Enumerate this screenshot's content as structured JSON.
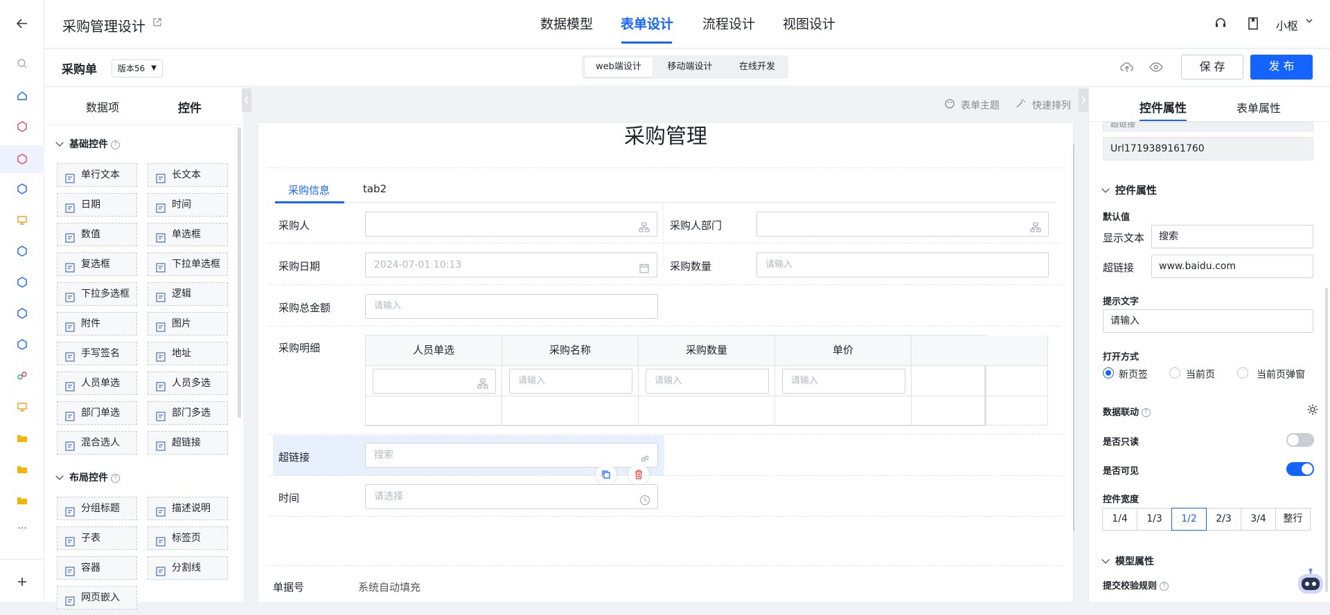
{
  "header": {
    "app_title": "采购管理设计",
    "tabs": [
      "数据模型",
      "表单设计",
      "流程设计",
      "视图设计"
    ],
    "active_tab": "表单设计",
    "user": "小枢"
  },
  "subheader": {
    "form_name": "采购单",
    "version": "版本56",
    "modes": [
      "web端设计",
      "移动端设计",
      "在线开发"
    ],
    "active_mode": "web端设计",
    "save_label": "保 存",
    "publish_label": "发 布"
  },
  "left_panel": {
    "tabs": [
      "数据项",
      "控件"
    ],
    "active_tab": "控件",
    "sections": [
      {
        "title": "基础控件",
        "items": [
          "单行文本",
          "长文本",
          "日期",
          "时间",
          "数值",
          "单选框",
          "复选框",
          "下拉单选框",
          "下拉多选框",
          "逻辑",
          "附件",
          "图片",
          "手写签名",
          "地址",
          "人员单选",
          "人员多选",
          "部门单选",
          "部门多选",
          "混合选人",
          "超链接"
        ]
      },
      {
        "title": "布局控件",
        "items": [
          "分组标题",
          "描述说明",
          "子表",
          "标签页",
          "容器",
          "分割线",
          "网页嵌入"
        ]
      }
    ]
  },
  "canvas": {
    "toolbar": [
      "表单主题",
      "快速排列"
    ],
    "form_title": "采购管理",
    "tabs": [
      "采购信息",
      "tab2"
    ],
    "active_tab": "采购信息",
    "fields": {
      "buyer": {
        "label": "采购人"
      },
      "buyer_dept": {
        "label": "采购人部门"
      },
      "purchase_date": {
        "label": "采购日期",
        "value": "2024-07-01 10:13"
      },
      "purchase_qty": {
        "label": "采购数量",
        "placeholder": "请输入"
      },
      "total_amount": {
        "label": "采购总金额",
        "placeholder": "请输入"
      },
      "details": {
        "label": "采购明细"
      },
      "hyperlink": {
        "label": "超链接",
        "value": "搜索"
      },
      "time": {
        "label": "时间",
        "placeholder": "请选择"
      },
      "doc_no": {
        "label": "单据号",
        "value": "系统自动填充"
      }
    },
    "subtable": {
      "columns": [
        "人员单选",
        "采购名称",
        "采购数量",
        "单价"
      ],
      "placeholder": "请输入"
    }
  },
  "right_panel": {
    "tabs": [
      "控件属性",
      "表单属性"
    ],
    "active_tab": "控件属性",
    "field_code_label": "超链接",
    "field_code": "Url1719389161760",
    "control_props_title": "控件属性",
    "default_value_label": "默认值",
    "display_text_label": "显示文本",
    "display_text_value": "搜索",
    "hyperlink_label": "超链接",
    "hyperlink_value": "www.baidu.com",
    "hint_label": "提示文字",
    "hint_value": "请输入",
    "open_mode_label": "打开方式",
    "open_modes": [
      "新页签",
      "当前页",
      "当前页弹窗"
    ],
    "open_mode_selected": "新页签",
    "data_link_label": "数据联动",
    "readonly_label": "是否只读",
    "readonly": false,
    "visible_label": "是否可见",
    "visible": true,
    "width_label": "控件宽度",
    "widths": [
      "1/4",
      "1/3",
      "1/2",
      "2/3",
      "3/4",
      "整行"
    ],
    "width_selected": "1/2",
    "model_props_title": "模型属性",
    "validation_label": "提交校验规则"
  },
  "colors": {
    "accent": "#1664ff",
    "danger": "#f0453b",
    "selected_bg": "#e8f0fd"
  }
}
